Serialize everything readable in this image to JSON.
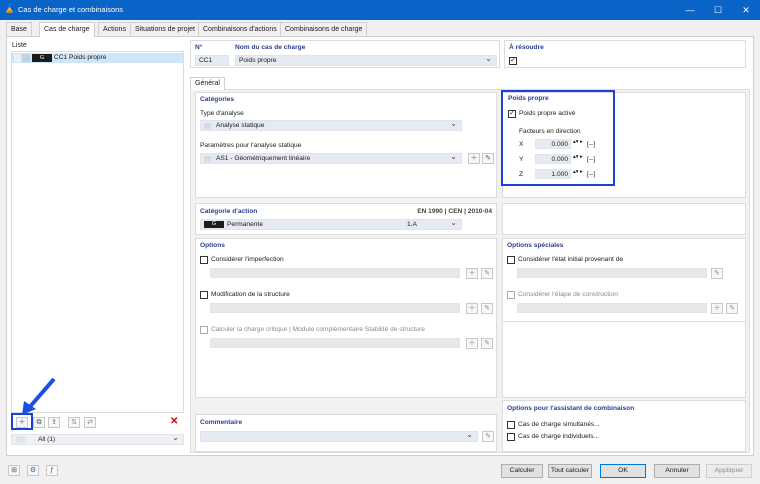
{
  "window": {
    "title": "Cas de charge et combinaisons",
    "min": "—",
    "max": "☐",
    "close": "✕"
  },
  "tabs": [
    "Base",
    "Cas de charge",
    "Actions",
    "Situations de projet",
    "Combinaisons d'actions",
    "Combinaisons de charge"
  ],
  "list": {
    "header": "Liste",
    "item_badge": "G",
    "item_id": "CC1",
    "item_name": "Poids propre",
    "filter": "All (1)"
  },
  "header_fields": {
    "no_label": "N°",
    "no_value": "CC1",
    "name_label": "Nom du cas de charge",
    "name_value": "Poids propre",
    "solve_label": "À résoudre"
  },
  "subtab": "Général",
  "categories": {
    "title": "Catégories",
    "analysis_type_label": "Type d'analyse",
    "analysis_type_value": "Analyse statique",
    "static_params_label": "Paramètres pour l'analyse statique",
    "static_params_value": "AS1 - Géométriquement linéaire"
  },
  "self_weight": {
    "title": "Poids propre",
    "active_label": "Poids propre activé",
    "factors_label": "Facteurs en direction",
    "rows": [
      {
        "axis": "X",
        "value": "0.000",
        "unit": "[--]"
      },
      {
        "axis": "Y",
        "value": "0.000",
        "unit": "[--]"
      },
      {
        "axis": "Z",
        "value": "1.000",
        "unit": "[--]"
      }
    ]
  },
  "action_category": {
    "title": "Catégorie d'action",
    "norm": "EN 1990 | CEN | 2010-04",
    "badge": "G",
    "value": "Permanente",
    "code": "1.A"
  },
  "options": {
    "title": "Options",
    "imperfection": "Considérer l'imperfection",
    "structure_mod": "Modification de la structure",
    "critical_load": "Calculer la charge critique | Module complémentaire Stabilité de structure"
  },
  "special_options": {
    "title": "Options spéciales",
    "initial_state": "Considérer l'état initial provenant de",
    "construction_stage": "Considérer l'étape de construction"
  },
  "combo_assistant": {
    "title": "Options pour l'assistant de combinaison",
    "simultaneous": "Cas de charge simultanés...",
    "individual": "Cas de charge individuels..."
  },
  "comment": {
    "title": "Commentaire"
  },
  "footer": {
    "calculate": "Calculer",
    "calculate_all": "Tout calculer",
    "ok": "OK",
    "cancel": "Annuler",
    "apply": "Appliquer"
  }
}
